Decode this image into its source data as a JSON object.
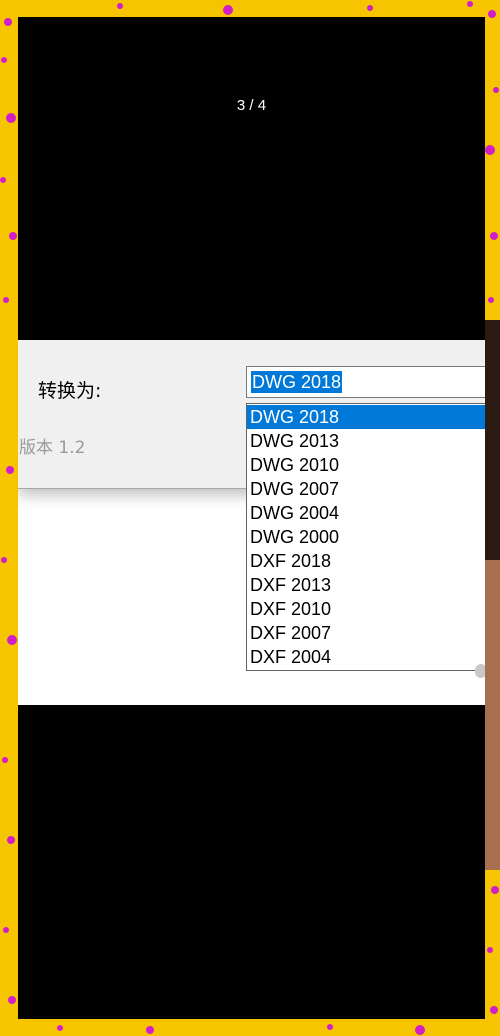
{
  "viewer": {
    "counter": "3 / 4"
  },
  "dialog": {
    "convert_label": "转换为:",
    "combo_value": "DWG 2018",
    "version": "版本 1.2"
  },
  "dropdown": {
    "options": [
      "DWG 2018",
      "DWG 2013",
      "DWG 2010",
      "DWG 2007",
      "DWG 2004",
      "DWG 2000",
      "DXF 2018",
      "DXF 2013",
      "DXF 2010",
      "DXF 2007",
      "DXF 2004"
    ],
    "selected": "DWG 2018"
  },
  "colors": {
    "frame": "#f7c400",
    "dots": "#d21ec8",
    "selection": "#0078d7"
  }
}
